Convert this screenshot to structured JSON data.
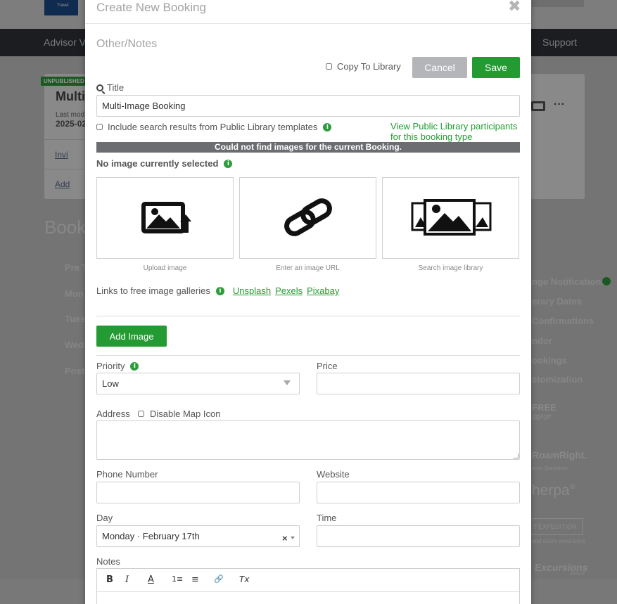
{
  "background": {
    "logo_text": "Travel",
    "nav": {
      "advisor": "Advisor Vi",
      "support": "Support"
    },
    "card": {
      "badge": "UNPUBLISHED",
      "title": "Multi",
      "last_modified": "Last mod",
      "date": "2025-02",
      "invite": "Invi",
      "add": "Add"
    },
    "heading": "Book",
    "left_items": [
      "Pre T",
      "Mon",
      "Tues",
      "Wed",
      "Post"
    ],
    "right_items": [
      "nge Notifications",
      "erary Dates",
      "Confirmations",
      "ndor",
      "ookings",
      "stomization"
    ],
    "partner_logos": [
      "FREE",
      "ggage",
      "RoamRight.",
      "ance Specialists",
      "herpa°",
      "T EXPEDITION",
      "and shore excursions",
      "Excursions",
      "GROUP"
    ]
  },
  "modal": {
    "title": "Create New Booking",
    "section": "Other/Notes",
    "copy_to_library": "Copy To Library",
    "cancel": "Cancel",
    "save": "Save",
    "title_label": "Title",
    "title_value": "Multi-Image Booking",
    "include_public": "Include search results from Public Library templates",
    "view_public": "View Public Library participants for this booking type",
    "notice": "Could not find images for the current Booking.",
    "no_image": "No image currently selected",
    "tiles": [
      "Upload image",
      "Enter an image URL",
      "Search image library"
    ],
    "links_label": "Links to free image galleries",
    "gallery_links": [
      "Unsplash",
      "Pexels",
      "Pixabay"
    ],
    "add_image": "Add Image",
    "priority_label": "Priority",
    "priority_value": "Low",
    "price_label": "Price",
    "price_value": "",
    "address_label": "Address",
    "disable_map": "Disable Map Icon",
    "address_value": "",
    "phone_label": "Phone Number",
    "phone_value": "",
    "website_label": "Website",
    "website_value": "",
    "day_label": "Day",
    "day_value": "Monday · February 17th",
    "clear": "×",
    "time_label": "Time",
    "time_value": "",
    "notes_label": "Notes",
    "toolbar": [
      "B",
      "I",
      "A",
      "1≡",
      "≡",
      "🔗",
      "Tx"
    ]
  },
  "colors": {
    "accent": "#239b32",
    "cancel": "#b3b5b8",
    "notice": "#6b6d70"
  }
}
